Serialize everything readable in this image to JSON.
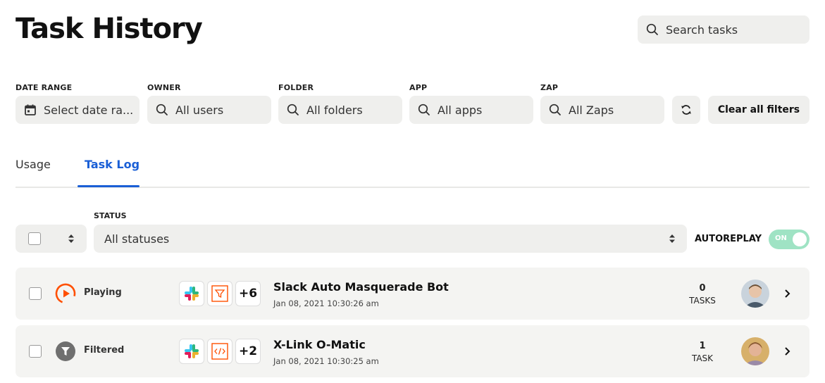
{
  "header": {
    "title": "Task History"
  },
  "search": {
    "placeholder": "Search tasks"
  },
  "filters": [
    {
      "label": "DATE RANGE",
      "value": "Select date ra...",
      "icon": "calendar-icon"
    },
    {
      "label": "OWNER",
      "value": "All users",
      "icon": "search-icon"
    },
    {
      "label": "FOLDER",
      "value": "All folders",
      "icon": "search-icon"
    },
    {
      "label": "APP",
      "value": "All apps",
      "icon": "search-icon"
    },
    {
      "label": "ZAP",
      "value": "All Zaps",
      "icon": "search-icon"
    }
  ],
  "toolbar": {
    "clear_label": "Clear all filters",
    "refresh_icon": "refresh-icon"
  },
  "tabs": [
    {
      "label": "Usage",
      "active": false
    },
    {
      "label": "Task Log",
      "active": true
    }
  ],
  "status": {
    "label": "STATUS",
    "value": "All statuses"
  },
  "autoreplay": {
    "label": "AUTOREPLAY",
    "toggle_text": "ON",
    "enabled": true
  },
  "colors": {
    "accent": "#1a5fd6",
    "toggle_on": "#9fe3c4",
    "playing": "#ff4f00",
    "filtered": "#6f6f6f"
  },
  "rows": [
    {
      "status": "Playing",
      "status_icon": "play-circle-icon",
      "apps": [
        "slack-icon",
        "filter-icon"
      ],
      "extra_apps": "+6",
      "name": "Slack Auto Masquerade Bot",
      "date": "Jan 08, 2021 10:30:26 am",
      "task_count": "0",
      "task_unit": "TASKS"
    },
    {
      "status": "Filtered",
      "status_icon": "filter-circle-icon",
      "apps": [
        "slack-icon",
        "code-icon"
      ],
      "extra_apps": "+2",
      "name": "X-Link O-Matic",
      "date": "Jan 08, 2021 10:30:25 am",
      "task_count": "1",
      "task_unit": "TASK"
    }
  ]
}
